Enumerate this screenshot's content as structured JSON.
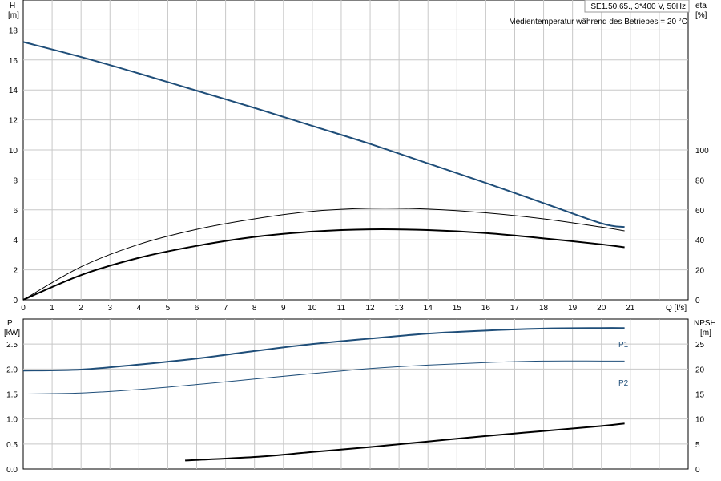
{
  "chart_data": [
    {
      "type": "line",
      "info_box": "SE1.50.65., 3*400 V, 50Hz",
      "note": "Medientemperatur während des Betriebes = 20 °C",
      "x_axis": {
        "label": "Q [l/s]",
        "range": [
          0,
          23
        ],
        "ticks": [
          "0",
          "1",
          "2",
          "3",
          "4",
          "5",
          "6",
          "7",
          "8",
          "9",
          "10",
          "11",
          "12",
          "13",
          "14",
          "15",
          "16",
          "17",
          "18",
          "19",
          "20",
          "21"
        ]
      },
      "y_left": {
        "label_top": "H",
        "label_unit": "[m]",
        "range": [
          0,
          20
        ],
        "ticks": [
          "0",
          "2",
          "4",
          "6",
          "8",
          "10",
          "12",
          "14",
          "16",
          "18"
        ]
      },
      "y_right": {
        "label_top": "eta",
        "label_unit": "[%]",
        "range": [
          0,
          200
        ],
        "ticks": [
          "0",
          "20",
          "40",
          "60",
          "80",
          "100"
        ]
      },
      "grid": true,
      "series": [
        {
          "axis": "left",
          "color": "#1f4e79",
          "width": 2.0,
          "x": [
            0,
            2,
            4,
            6,
            8,
            10,
            12,
            14,
            16,
            18,
            20,
            20.8
          ],
          "y": [
            17.2,
            16.2,
            15.1,
            13.95,
            12.8,
            11.6,
            10.4,
            9.1,
            7.8,
            6.45,
            5.1,
            4.85
          ]
        },
        {
          "axis": "right",
          "color": "#000000",
          "width": 1.0,
          "x": [
            0,
            2,
            4,
            6,
            8,
            10,
            12,
            14,
            16,
            18,
            20,
            20.8
          ],
          "y": [
            0,
            22,
            37,
            47,
            54,
            59,
            61,
            60.5,
            58,
            54,
            48.5,
            46
          ]
        },
        {
          "axis": "right",
          "color": "#000000",
          "width": 2.0,
          "x": [
            0,
            2,
            4,
            6,
            8,
            10,
            12,
            14,
            16,
            18,
            20,
            20.8
          ],
          "y": [
            0,
            16.5,
            28,
            36,
            42,
            45.5,
            47,
            46.5,
            44.5,
            41,
            37,
            35
          ]
        }
      ]
    },
    {
      "type": "line",
      "x_axis": {
        "range": [
          0,
          23
        ]
      },
      "y_left": {
        "label_top": "P",
        "label_unit": "[kW]",
        "range": [
          0,
          3.0
        ],
        "ticks": [
          "0.0",
          "0.5",
          "1.0",
          "1.5",
          "2.0",
          "2.5"
        ]
      },
      "y_right": {
        "label_top": "NPSH",
        "label_unit": "[m]",
        "range": [
          0,
          30
        ],
        "ticks": [
          "0",
          "5",
          "10",
          "15",
          "20",
          "25"
        ]
      },
      "grid": true,
      "series": [
        {
          "name": "P1",
          "axis": "left",
          "color": "#1f4e79",
          "width": 2.0,
          "x": [
            0,
            2,
            4,
            6,
            8,
            10,
            12,
            14,
            16,
            18,
            20,
            20.8
          ],
          "y": [
            1.97,
            1.99,
            2.09,
            2.21,
            2.36,
            2.5,
            2.61,
            2.71,
            2.77,
            2.81,
            2.82,
            2.82
          ]
        },
        {
          "name": "P2",
          "axis": "left",
          "color": "#1f4e79",
          "width": 1.0,
          "x": [
            0,
            2,
            4,
            6,
            8,
            10,
            12,
            14,
            16,
            18,
            20,
            20.8
          ],
          "y": [
            1.5,
            1.52,
            1.59,
            1.69,
            1.8,
            1.91,
            2.01,
            2.08,
            2.13,
            2.16,
            2.16,
            2.16
          ]
        },
        {
          "axis": "right",
          "color": "#000000",
          "width": 2.0,
          "x": [
            5.6,
            8,
            10,
            12,
            14,
            16,
            18,
            20,
            20.8
          ],
          "y": [
            1.7,
            2.4,
            3.4,
            4.4,
            5.5,
            6.6,
            7.6,
            8.6,
            9.1
          ]
        }
      ]
    }
  ]
}
